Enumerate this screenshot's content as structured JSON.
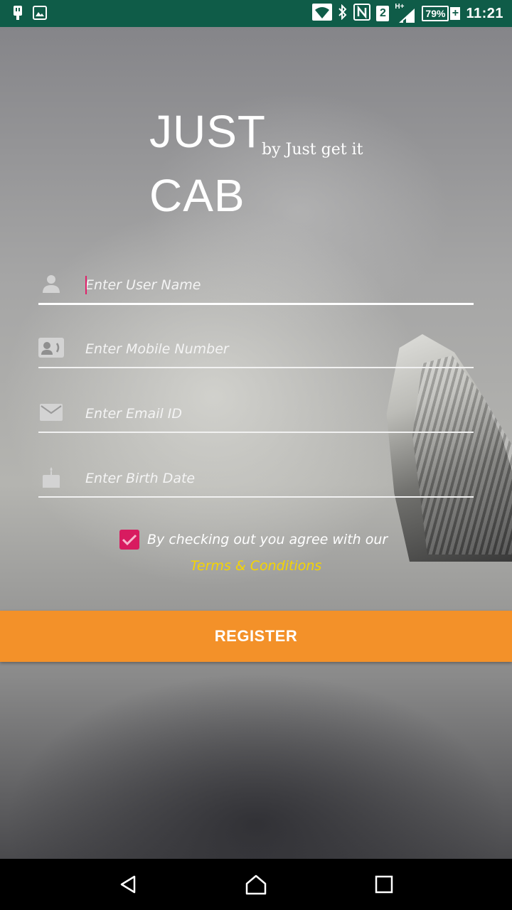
{
  "status_bar": {
    "time": "11:21",
    "battery": "79%",
    "sim": "2",
    "network": "H+",
    "icons": [
      "usb-icon",
      "image-icon",
      "wifi-icon",
      "bluetooth-icon",
      "nfc-icon",
      "signal-icon",
      "battery-icon"
    ]
  },
  "logo": {
    "title": "JUST CAB",
    "subtitle": "by Just get it"
  },
  "form": {
    "username_placeholder": "Enter User Name",
    "mobile_placeholder": "Enter Mobile Number",
    "email_placeholder": "Enter Email ID",
    "birthdate_placeholder": "Enter Birth Date",
    "agree_checked": true,
    "agree_text": "By checking out you agree with our",
    "terms_link": "Terms & Conditions",
    "register_label": "REGISTER"
  },
  "colors": {
    "status_bar": "#0f5c48",
    "accent_button": "#f39129",
    "checkbox": "#d81b60",
    "link": "#f5d400"
  },
  "nav_bar": {
    "icons": [
      "back-icon",
      "home-icon",
      "recents-icon"
    ]
  }
}
